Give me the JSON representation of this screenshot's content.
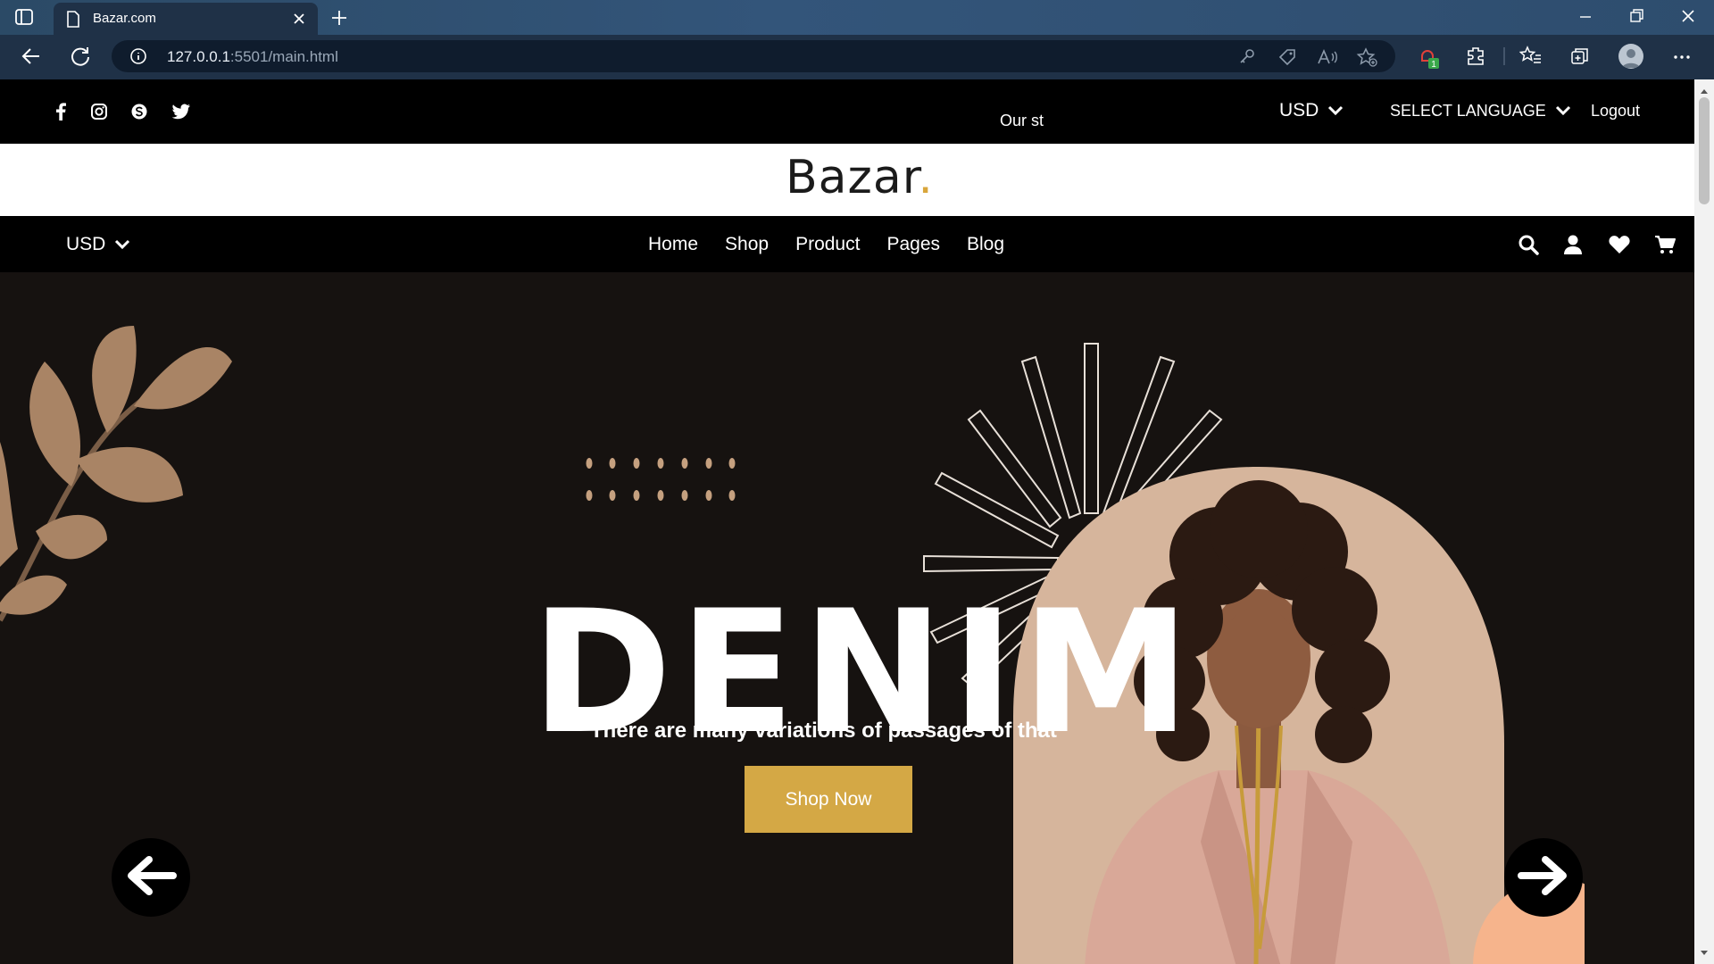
{
  "browser": {
    "tab_title": "Bazar.com",
    "url_host": "127.0.0.1",
    "url_rest": ":5501/main.html",
    "extension_badge": "1"
  },
  "topbar": {
    "social_icons": [
      "facebook-icon",
      "instagram-icon",
      "skype-icon",
      "twitter-icon"
    ],
    "marquee_text": "Our st",
    "currency": "USD",
    "language": "SELECT LANGUAGE",
    "logout": "Logout"
  },
  "logo": {
    "text": "Bazar",
    "dot": "."
  },
  "navbar": {
    "currency": "USD",
    "menu": [
      "Home",
      "Shop",
      "Product",
      "Pages",
      "Blog"
    ],
    "icons": [
      "search-icon",
      "user-icon",
      "heart-icon",
      "cart-icon"
    ]
  },
  "hero": {
    "title": "DENIM",
    "subtitle": "There are many variations of passages of that",
    "button": "Shop Now"
  },
  "colors": {
    "accent": "#d4a845",
    "hero_bg": "#161210",
    "leaf": "#a98465",
    "portrait_bg": "#d6b59c"
  }
}
